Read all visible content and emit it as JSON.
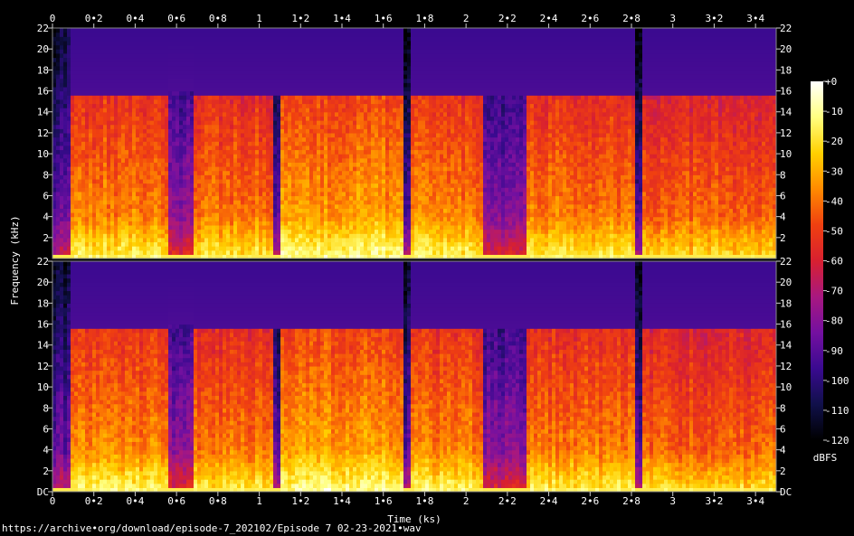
{
  "chart_data": {
    "type": "heatmap",
    "xlabel": "Time (ks)",
    "ylabel": "Frequency (kHz)",
    "colorbar_label": "dBFS",
    "xlim": [
      0,
      3.5
    ],
    "x_ticks": [
      "0",
      "0•2",
      "0•4",
      "0•6",
      "0•8",
      "1",
      "1•2",
      "1•4",
      "1•6",
      "1•8",
      "2",
      "2•2",
      "2•4",
      "2•6",
      "2•8",
      "3",
      "3•2",
      "3•4"
    ],
    "ylim": [
      0,
      22
    ],
    "y_ticks_top": [
      "22",
      "20",
      "18",
      "16",
      "14",
      "12",
      "10",
      "8",
      "6",
      "4",
      "2"
    ],
    "y_ticks_bottom": [
      "DC",
      "2",
      "4",
      "6",
      "8",
      "10",
      "12",
      "14",
      "16",
      "18",
      "20",
      "22"
    ],
    "colorbar_range": [
      -120,
      0
    ],
    "colorbar_ticks": [
      "+0",
      "-10",
      "-20",
      "-30",
      "-40",
      "-50",
      "-60",
      "-70",
      "-80",
      "-90",
      "-100",
      "-110",
      "-120"
    ],
    "colormap": [
      "#000000",
      "#10104a",
      "#3a0a90",
      "#7410a0",
      "#a81880",
      "#d82030",
      "#f04010",
      "#ff8a00",
      "#ffd000",
      "#ffff80",
      "#ffffff"
    ],
    "channels": 2,
    "cutoff_khz": 15.4,
    "segments": [
      {
        "start": 0.0,
        "end": 0.095,
        "level": 0.32,
        "cutoff": 22
      },
      {
        "start": 0.095,
        "end": 0.555,
        "level": 0.74
      },
      {
        "start": 0.555,
        "end": 0.69,
        "level": 0.4,
        "cutoff": 16
      },
      {
        "start": 0.69,
        "end": 1.075,
        "level": 0.72
      },
      {
        "start": 1.075,
        "end": 1.1,
        "level": 0.3
      },
      {
        "start": 1.1,
        "end": 1.7,
        "level": 0.78
      },
      {
        "start": 1.7,
        "end": 1.735,
        "level": 0.3,
        "cutoff": 22
      },
      {
        "start": 1.735,
        "end": 2.08,
        "level": 0.74
      },
      {
        "start": 2.08,
        "end": 2.3,
        "level": 0.38
      },
      {
        "start": 2.3,
        "end": 2.82,
        "level": 0.73
      },
      {
        "start": 2.82,
        "end": 2.85,
        "level": 0.3,
        "cutoff": 22
      },
      {
        "start": 2.85,
        "end": 3.5,
        "level": 0.69
      }
    ],
    "source": "https://archive•org/download/episode-7_202102/Episode 7 02-23-2021•wav"
  }
}
